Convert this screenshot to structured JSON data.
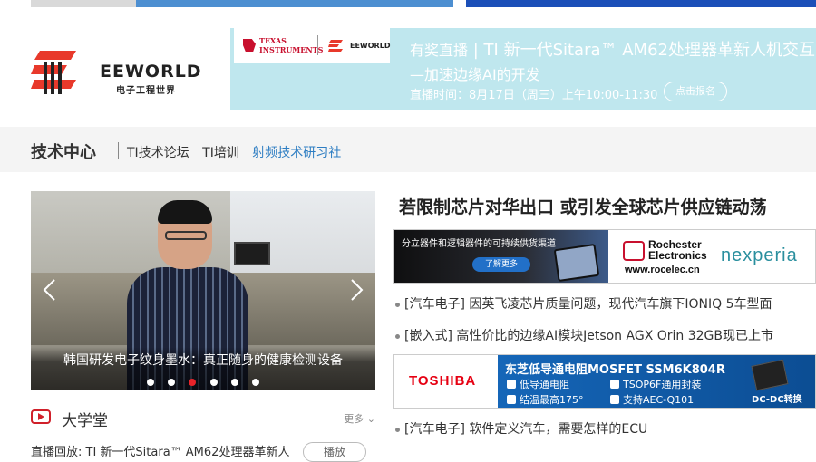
{
  "header": {
    "brand": "EEWORLD",
    "brand_sub": "电子工程世界"
  },
  "banner": {
    "sponsor_ti": "TEXAS INSTRUMENTS",
    "sponsor_ee": "EEWORLD",
    "line1_prefix": "有奖直播",
    "line1_main": "TI 新一代Sitara™ AM62处理器革新人机交互",
    "line2": "—加速边缘AI的开发",
    "line3": "直播时间：8月17日（周三）上午10:00-11:30",
    "register": "点击报名"
  },
  "nav": {
    "title": "技术中心",
    "links": [
      "TI技术论坛",
      "TI培训",
      "射频技术研习社"
    ]
  },
  "slider": {
    "caption": "韩国研发电子纹身墨水：真正随身的健康检测设备",
    "dot_count": 6,
    "active_dot": 2
  },
  "daxuetang": {
    "label": "大学堂",
    "more": "更多",
    "live_text": "直播回放: TI 新一代Sitara™ AM62处理器革新人",
    "play": "播放"
  },
  "main": {
    "headline": "若限制芯片对华出口 或引发全球芯片供应链动荡",
    "ad1": {
      "slogan": "分立器件和逻辑器件的可持续供货渠道",
      "learn_more": "了解更多",
      "rochester": "Rochester Electronics",
      "rochester_url": "www.rocelec.cn",
      "nexperia": "nexperia"
    },
    "news": [
      {
        "tag": "[汽车电子]",
        "title": "因英飞凌芯片质量问题，现代汽车旗下IONIQ 5车型面"
      },
      {
        "tag": "[嵌入式]",
        "title": "高性价比的边缘AI模块Jetson AGX Orin 32GB现已上市"
      },
      {
        "tag": "[汽车电子]",
        "title": "软件定义汽车，需要怎样的ECU"
      }
    ],
    "ad2": {
      "brand": "TOSHIBA",
      "title": "东芝低导通电阻MOSFET SSM6K804R",
      "feat1": "低导通电阻",
      "feat2": "TSOP6F通用封装",
      "feat3": "结温最高175°",
      "feat4": "支持AEC-Q101",
      "tag": "DC-DC转换"
    }
  }
}
